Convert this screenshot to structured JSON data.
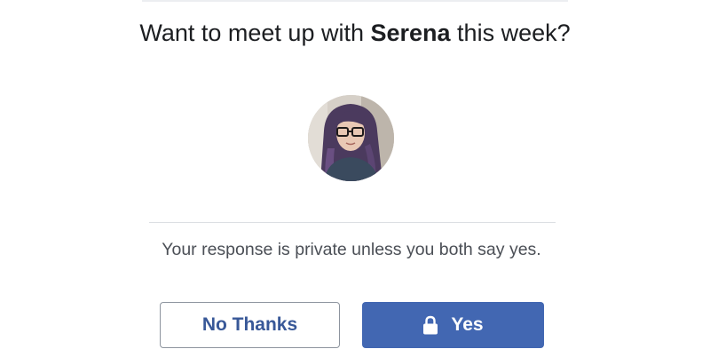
{
  "prompt": {
    "prefix": "Want to meet up with ",
    "name": "Serena",
    "suffix": " this week?"
  },
  "avatar": {
    "alt": "Serena"
  },
  "privacy_note": "Your response is private unless you both say yes.",
  "buttons": {
    "no_label": "No Thanks",
    "yes_label": "Yes",
    "yes_icon": "lock-icon"
  },
  "colors": {
    "primary": "#4267b2",
    "link_text": "#385898",
    "secondary_border": "#8d949e",
    "muted_text": "#4b4f56"
  }
}
